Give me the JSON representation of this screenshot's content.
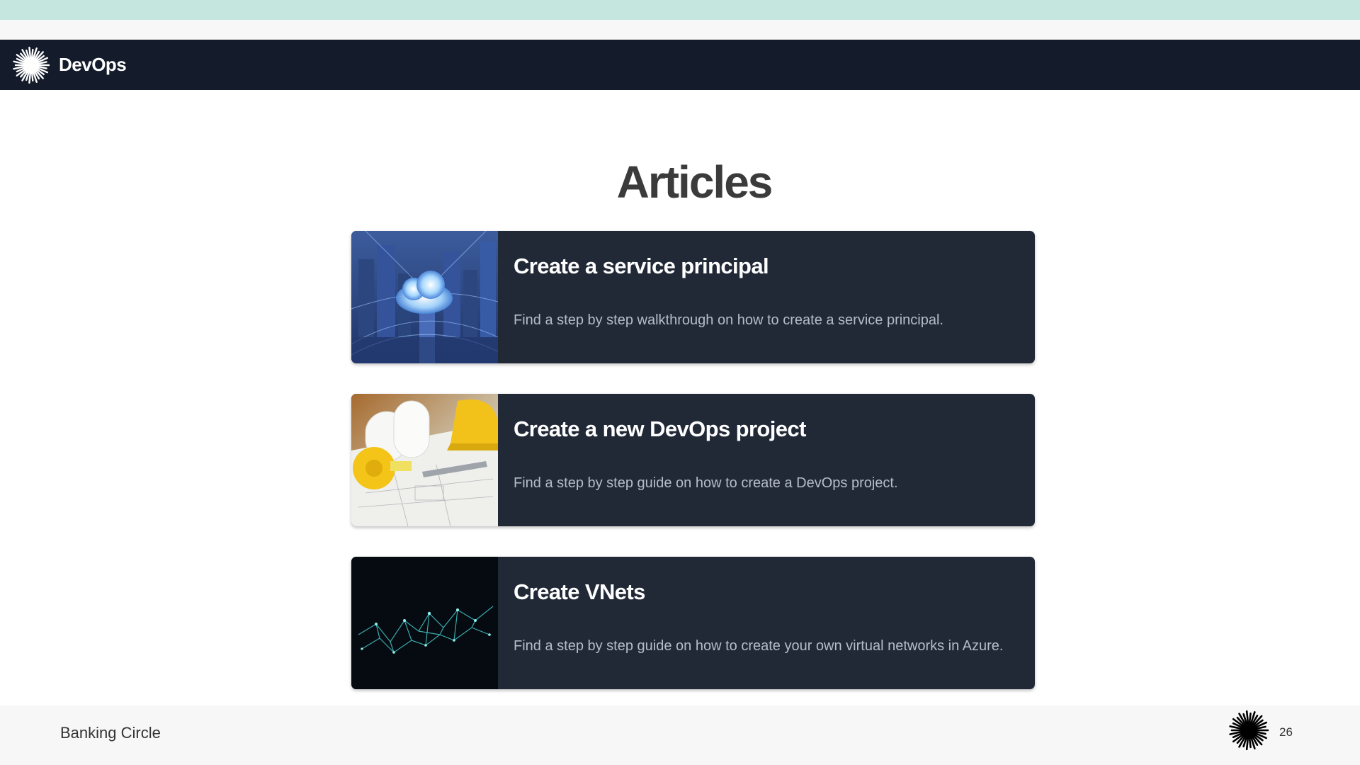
{
  "header": {
    "brand": "DevOps",
    "logo_icon": "sunburst-logo-icon",
    "background_color": "#141b2b"
  },
  "top_band_color": "#c5e6df",
  "page_title": "Articles",
  "articles": [
    {
      "title": "Create a service principal",
      "description": "Find a step by step walkthrough on how to create a service principal.",
      "image": "cloud-city-image"
    },
    {
      "title": "Create a new DevOps project",
      "description": "Find a step by step guide on how to create a DevOps project.",
      "image": "construction-tools-image"
    },
    {
      "title": "Create VNets",
      "description": "Find a step by step guide on how to create your own virtual networks in Azure.",
      "image": "network-mesh-image"
    }
  ],
  "card_color": "#212937",
  "footer": {
    "company": "Banking Circle",
    "page_number": "26",
    "logo_icon": "sunburst-logo-icon"
  }
}
